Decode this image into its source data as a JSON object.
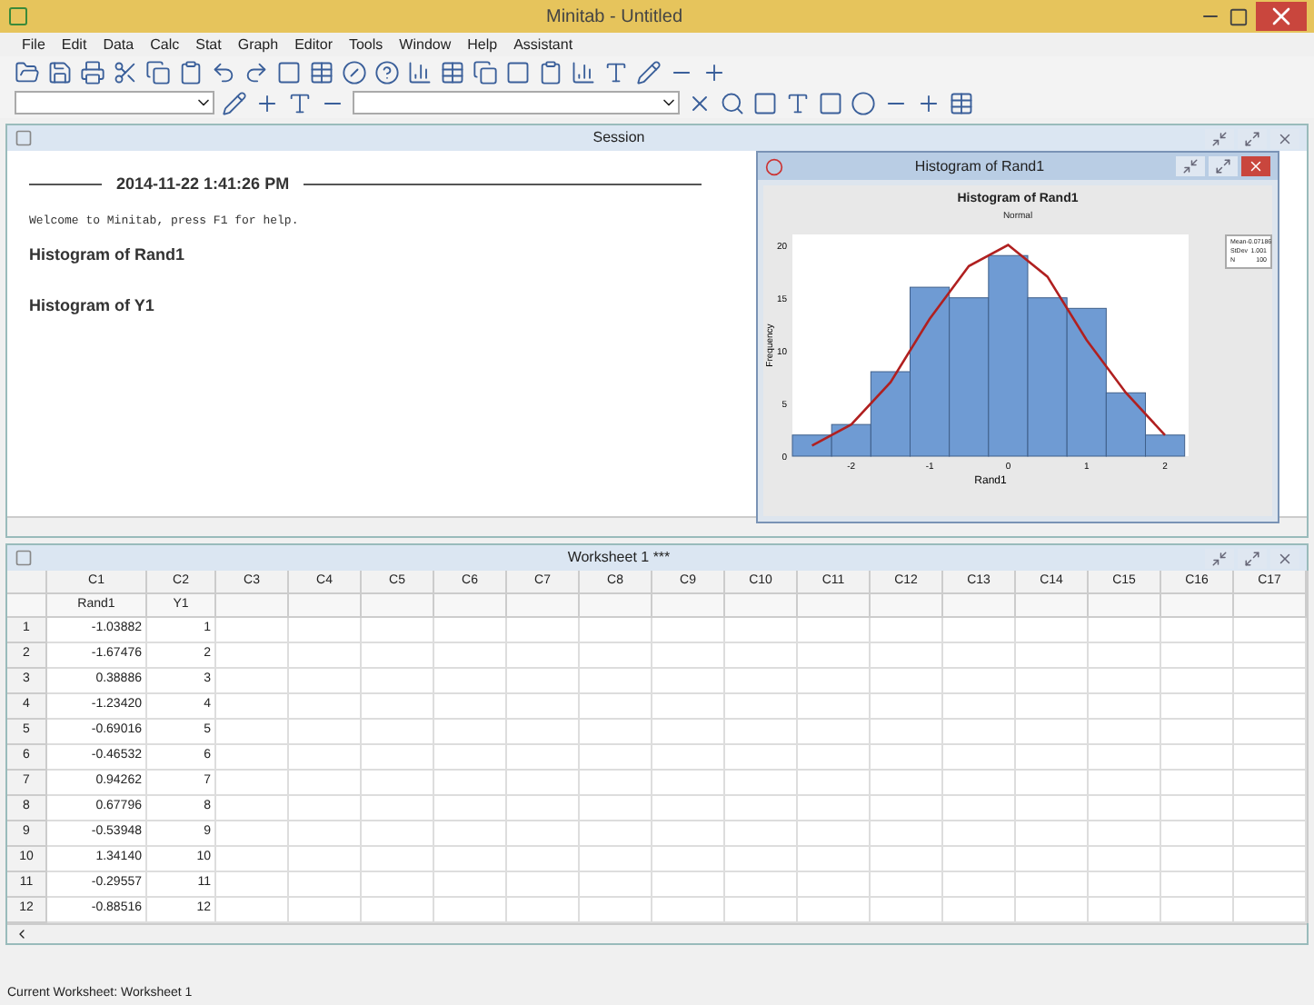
{
  "window": {
    "title": "Minitab - Untitled"
  },
  "menu": [
    "File",
    "Edit",
    "Data",
    "Calc",
    "Stat",
    "Graph",
    "Editor",
    "Tools",
    "Window",
    "Help",
    "Assistant"
  ],
  "session": {
    "title": "Session",
    "timestamp": "2014-11-22 1:41:26 PM",
    "welcome": "Welcome to Minitab, press F1 for help.",
    "headings": [
      "Histogram of Rand1",
      "Histogram of Y1"
    ]
  },
  "graph_window": {
    "title": "Histogram of Rand1",
    "chart_title": "Histogram of Rand1",
    "subtitle": "Normal",
    "legend": [
      {
        "label": "Mean",
        "value": "-0.07186"
      },
      {
        "label": "StDev",
        "value": "1.001"
      },
      {
        "label": "N",
        "value": "100"
      }
    ],
    "chart_data": {
      "type": "bar",
      "xlabel": "Rand1",
      "ylabel": "Frequency",
      "x": [
        -2.5,
        -2,
        -1.5,
        -1,
        -0.5,
        0,
        0.5,
        1,
        1.5,
        2
      ],
      "series": [
        {
          "type": "bar",
          "color": "#6f9bd3",
          "values": [
            2,
            3,
            8,
            16,
            15,
            19,
            15,
            14,
            6,
            2
          ]
        },
        {
          "type": "line",
          "color": "#b02020",
          "values": [
            1,
            3,
            7,
            13,
            18,
            20,
            17,
            11,
            6,
            2
          ]
        }
      ],
      "xticks": [
        -2,
        -1,
        0,
        1,
        2
      ],
      "yticks": [
        0,
        5,
        10,
        15,
        20
      ],
      "xlim": [
        -2.75,
        2.3
      ],
      "ylim": [
        0,
        21
      ]
    }
  },
  "worksheet": {
    "title": "Worksheet 1 ***",
    "columns": [
      "C1",
      "C2",
      "C3",
      "C4",
      "C5",
      "C6",
      "C7",
      "C8",
      "C9",
      "C10",
      "C11",
      "C12",
      "C13",
      "C14",
      "C15",
      "C16",
      "C17"
    ],
    "column_names": [
      "Rand1",
      "Y1"
    ],
    "rows": [
      {
        "number": "1",
        "cells": [
          "-1.03882",
          "1"
        ]
      },
      {
        "number": "2",
        "cells": [
          "-1.67476",
          "2"
        ]
      },
      {
        "number": "3",
        "cells": [
          "0.38886",
          "3"
        ]
      },
      {
        "number": "4",
        "cells": [
          "-1.23420",
          "4"
        ]
      },
      {
        "number": "5",
        "cells": [
          "-0.69016",
          "5"
        ]
      },
      {
        "number": "6",
        "cells": [
          "-0.46532",
          "6"
        ]
      },
      {
        "number": "7",
        "cells": [
          "0.94262",
          "7"
        ]
      },
      {
        "number": "8",
        "cells": [
          "0.67796",
          "8"
        ]
      },
      {
        "number": "9",
        "cells": [
          "-0.53948",
          "9"
        ]
      },
      {
        "number": "10",
        "cells": [
          "1.34140",
          "10"
        ]
      },
      {
        "number": "11",
        "cells": [
          "-0.29557",
          "11"
        ]
      },
      {
        "number": "12",
        "cells": [
          "-0.88516",
          "12"
        ]
      }
    ]
  },
  "status_bar": "Current Worksheet: Worksheet 1"
}
